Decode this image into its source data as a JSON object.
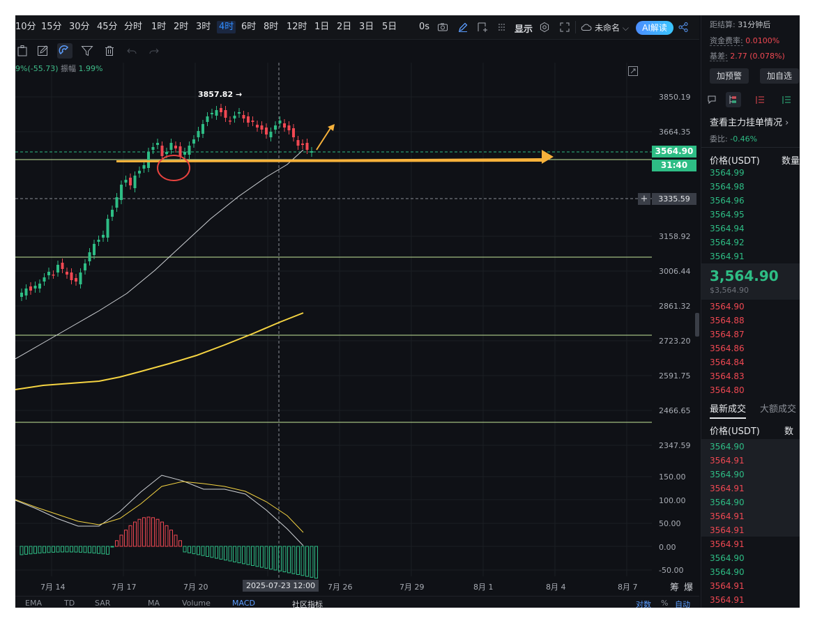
{
  "toolbar": {
    "timeframes": [
      "10分",
      "15分",
      "30分",
      "45分",
      "分时",
      "1时",
      "2时",
      "3时",
      "4时",
      "6时",
      "8时",
      "12时",
      "1日",
      "2日",
      "3日",
      "5日"
    ],
    "active_timeframe": "4时",
    "countdown_label": "0s",
    "display_label": "显示",
    "layout_name": "未命名",
    "ai_label": "AI解读"
  },
  "stats_line": {
    "change": "9%(-55.73)",
    "amplitude_label": "振幅",
    "amplitude_value": "1.99%"
  },
  "chart": {
    "high_label": "3857.82",
    "current_price_label": "3564.90",
    "countdown_badge": "31:40",
    "crosshair_price": "3335.59",
    "crosshair_date": "2025-07-23 12:00",
    "price_ticks": [
      "3850.19",
      "3664.35",
      "3158.92",
      "3006.44",
      "2861.32",
      "2723.20",
      "2591.75",
      "2466.65",
      "2347.59"
    ],
    "macd_ticks": [
      "150.00",
      "100.00",
      "50.00",
      "0.00",
      "-50.00"
    ],
    "date_ticks": [
      "7月 14",
      "7月 17",
      "7月 20",
      "7月 26",
      "7月 29",
      "8月 1",
      "8月 4",
      "8月 7"
    ],
    "axis_tail_labels": [
      "筹",
      "爆"
    ],
    "colors": {
      "up": "#2ebd85",
      "down": "#f04852",
      "ma_slow": "#f5d442",
      "ma_fast": "#cfd2d6",
      "arrow": "#f7b23b",
      "hline": "#c6e79a",
      "circle": "#e8433f"
    }
  },
  "bottom_bar": {
    "left_tabs": [
      "EMA",
      "TD",
      "SAR",
      "MA",
      "Volume",
      "MACD",
      "社区指标"
    ],
    "right_tabs": [
      "对数",
      "%",
      "自动"
    ]
  },
  "right_panel": {
    "settlement_label": "距结算:",
    "settlement_value": "31分钟后",
    "funding_label": "资金费率:",
    "funding_value": "0.0100%",
    "basis_label": "基差:",
    "basis_value": "2.77 (0.078%)",
    "alert_button": "加预警",
    "watch_button": "加自选",
    "main_orders_label": "查看主力挂单情况",
    "ratio_label": "委比:",
    "ratio_value": "-0.46%",
    "price_header": "价格(USDT)",
    "qty_header": "数量",
    "asks": [
      "3564.99",
      "3564.98",
      "3564.96",
      "3564.95",
      "3564.94",
      "3564.92",
      "3564.91"
    ],
    "last_price": "3,564.90",
    "last_price_sub": "$3,564.90",
    "bids": [
      "3564.90",
      "3564.88",
      "3564.87",
      "3564.86",
      "3564.84",
      "3564.83",
      "3564.80"
    ],
    "trades_tab": "最新成交",
    "big_trades_tab": "大额成交",
    "trades": [
      {
        "p": "3564.90",
        "s": "buy"
      },
      {
        "p": "3564.91",
        "s": "sell"
      },
      {
        "p": "3564.90",
        "s": "buy"
      },
      {
        "p": "3564.91",
        "s": "sell"
      },
      {
        "p": "3564.90",
        "s": "buy"
      },
      {
        "p": "3564.91",
        "s": "sell"
      },
      {
        "p": "3564.91",
        "s": "sell"
      },
      {
        "p": "3564.91",
        "s": "sell"
      },
      {
        "p": "3564.90",
        "s": "buy"
      },
      {
        "p": "3564.90",
        "s": "buy"
      },
      {
        "p": "3564.91",
        "s": "sell"
      },
      {
        "p": "3564.91",
        "s": "sell"
      }
    ]
  }
}
